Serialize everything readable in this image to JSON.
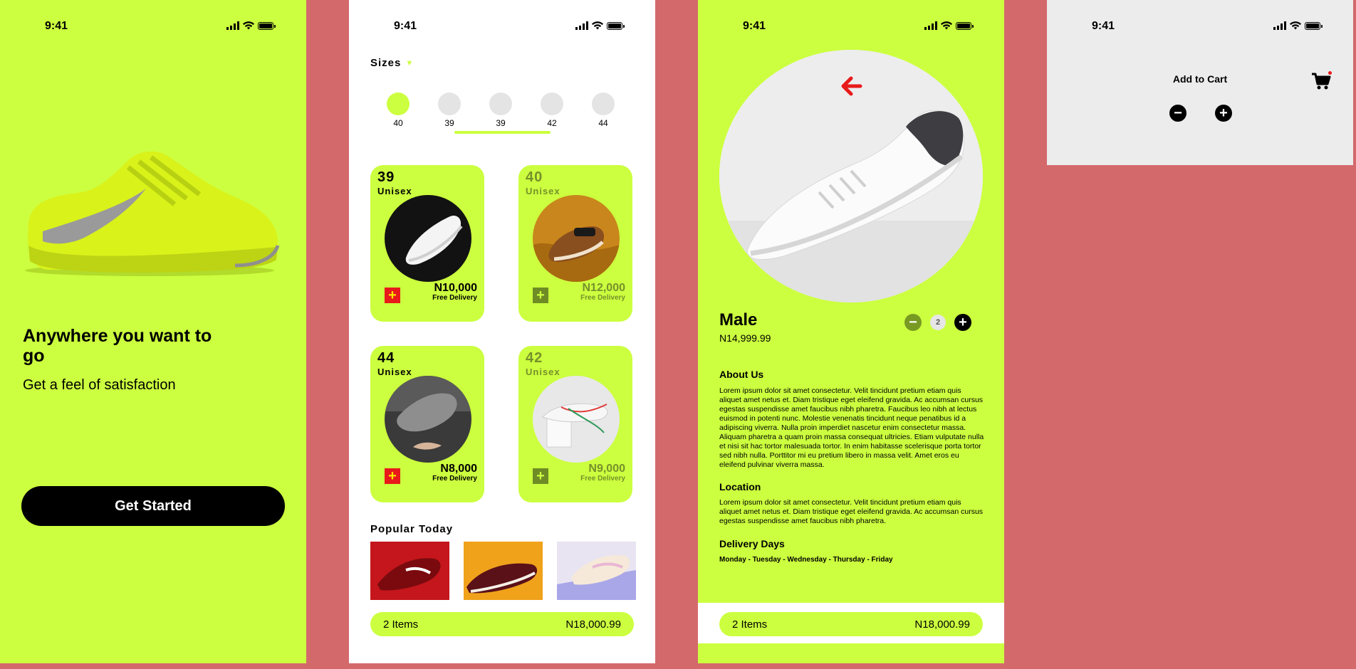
{
  "status": {
    "time": "9:41"
  },
  "onboarding": {
    "headline": "Anywhere you want to go",
    "subheadline": "Get a feel of satisfaction",
    "cta_label": "Get Started"
  },
  "catalog": {
    "sizes_title": "Sizes",
    "size_options": [
      {
        "label": "40",
        "selected": true
      },
      {
        "label": "39",
        "selected": false
      },
      {
        "label": "39",
        "selected": false
      },
      {
        "label": "42",
        "selected": false
      },
      {
        "label": "44",
        "selected": false
      }
    ],
    "products": [
      {
        "size": "39",
        "gender": "Unisex",
        "price": "N10,000",
        "delivery": "Free Delivery"
      },
      {
        "size": "40",
        "gender": "Unisex",
        "price": "N12,000",
        "delivery": "Free Delivery"
      },
      {
        "size": "44",
        "gender": "Unisex",
        "price": "N8,000",
        "delivery": "Free Delivery"
      },
      {
        "size": "42",
        "gender": "Unisex",
        "price": "N9,000",
        "delivery": "Free Delivery"
      }
    ],
    "popular_title": "Popular Today",
    "cart_bar": {
      "items": "2 Items",
      "total": "N18,000.99"
    }
  },
  "detail": {
    "title": "Male",
    "price": "N14,999.99",
    "quantity": "2",
    "about_title": "About Us",
    "about_text": "Lorem ipsum dolor sit amet consectetur. Velit tincidunt pretium etiam quis aliquet amet netus et. Diam tristique eget eleifend gravida. Ac accumsan cursus egestas suspendisse amet faucibus nibh pharetra. Faucibus leo nibh at lectus euismod in potenti nunc. Molestie venenatis tincidunt neque penatibus id a adipiscing viverra. Nulla proin imperdiet nascetur enim consectetur massa. Aliquam pharetra a quam proin massa consequat ultricies. Etiam vulputate nulla et nisi sit hac tortor malesuada tortor. In enim habitasse scelerisque porta tortor sed nibh nulla. Porttitor mi eu pretium libero in massa velit. Amet eros eu eleifend pulvinar viverra massa.",
    "location_title": "Location",
    "location_text": "Lorem ipsum dolor sit amet consectetur. Velit tincidunt pretium etiam quis aliquet amet netus et. Diam tristique eget eleifend gravida. Ac accumsan cursus egestas suspendisse amet faucibus nibh pharetra.",
    "delivery_title": "Delivery Days",
    "delivery_days": "Monday - Tuesday - Wednesday - Thursday - Friday",
    "cart_bar": {
      "items": "2 Items",
      "total": "N18,000.99"
    }
  },
  "cart": {
    "title": "Add to Cart"
  },
  "colors": {
    "accent": "#ccff3f",
    "background": "#d4696c",
    "plus_red": "#e81a1a"
  }
}
